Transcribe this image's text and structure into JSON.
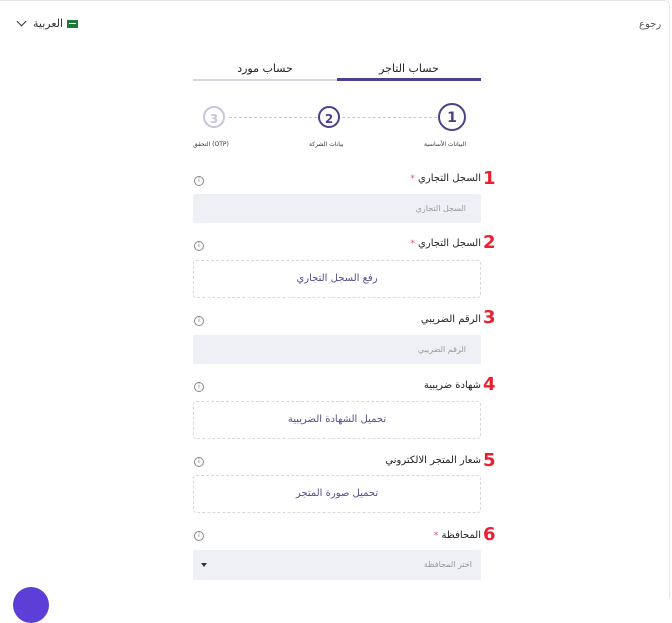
{
  "header": {
    "back_label": "رجوع",
    "language_label": "العربية"
  },
  "tabs": [
    {
      "label": "حساب مورد"
    },
    {
      "label": "حساب التاجر"
    }
  ],
  "steps": [
    {
      "number": "1",
      "label": "البيانات الأساسية"
    },
    {
      "number": "2",
      "label": "بيانات الشركة"
    },
    {
      "number": "3",
      "label": "التحقق (OTP)"
    }
  ],
  "fields": [
    {
      "marker": "1",
      "label": "السجل التجاري",
      "required": "*",
      "placeholder": "السجل التجاري"
    },
    {
      "marker": "2",
      "label": "السجل التجاري",
      "required": "*",
      "upload_label": "رفع السجل التجاري"
    },
    {
      "marker": "3",
      "label": "الرقم الضريبي",
      "placeholder": "الرقم الضريبي"
    },
    {
      "marker": "4",
      "label": "شهادة ضريبية",
      "upload_label": "تحميل الشهادة الضريبية"
    },
    {
      "marker": "5",
      "label": "شعار المتجر الالكتروني",
      "upload_label": "تحميل صورة المتجر"
    },
    {
      "marker": "6",
      "label": "المحافظة",
      "required": "*",
      "select_placeholder": "اختر المحافظة"
    }
  ],
  "info_glyph": "i",
  "colors": {
    "accent": "#4f3f8a",
    "marker_red": "#e8202f",
    "input_bg": "#eef0f6"
  }
}
